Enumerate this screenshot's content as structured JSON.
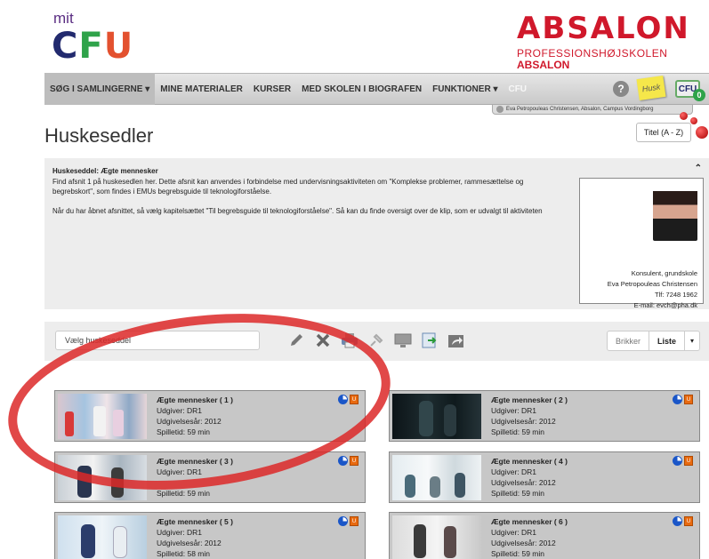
{
  "logo_left": {
    "mit": "mit",
    "c": "C",
    "f": "F",
    "u": "U"
  },
  "logo_right": {
    "name": "ABSALON",
    "sub1": "PROFESSIONSHØJSKOLEN",
    "sub2": "ABSALON"
  },
  "nav": {
    "items": [
      "SØG I SAMLINGERNE ▾",
      "MINE MATERIALER",
      "KURSER",
      "MED SKOLEN I BIOGRAFEN",
      "FUNKTIONER ▾",
      "CFU"
    ],
    "help": "?",
    "husk": "Husk",
    "cart_label": "CFU",
    "cart_count": "0"
  },
  "user": {
    "name": "Eva Petropouleas Christensen, Absalon, Campus Vordingborg"
  },
  "page_title": "Huskesedler",
  "sort": {
    "selected": "Titel (A - Z)"
  },
  "note": {
    "header": "Huskeseddel: Ægte mennesker",
    "p1": "Find afsnit 1 på huskesedlen her. Dette afsnit kan anvendes i forbindelse med undervisningsaktiviteten om \"Komplekse problemer, rammesættelse og begrebskort\", som findes i EMUs begrebsguide til teknologiforståelse.",
    "p2": "Når du har åbnet afsnittet, så vælg kapitelsættet \"Til begrebsguide til teknologiforståelse\". Så kan du finde oversigt over de klip, som er udvalgt til aktiviteten",
    "caret": "⌃"
  },
  "contact": {
    "role": "Konsulent, grundskole",
    "name": "Eva Petropouleas Christensen",
    "phone": "Tlf: 7248 1962",
    "email": "E-mail: evch@pha.dk"
  },
  "toolbar": {
    "select_placeholder": "Vælg huskeseddel",
    "view_bricks": "Brikker",
    "view_list": "Liste",
    "dd": "▾"
  },
  "cards": [
    {
      "title": "Ægte mennesker ( 1 )",
      "publisher": "Udgiver: DR1",
      "year": "Udgivelsesår: 2012",
      "duration": "Spilletid: 59 min",
      "badge": "U"
    },
    {
      "title": "Ægte mennesker ( 2 )",
      "publisher": "Udgiver: DR1",
      "year": "Udgivelsesår: 2012",
      "duration": "Spilletid: 59 min",
      "badge": "U"
    },
    {
      "title": "Ægte mennesker ( 3 )",
      "publisher": "Udgiver: DR1",
      "year": "",
      "duration": "Spilletid: 59 min",
      "badge": "U"
    },
    {
      "title": "Ægte mennesker ( 4 )",
      "publisher": "Udgiver: DR1",
      "year": "Udgivelsesår: 2012",
      "duration": "Spilletid: 59 min",
      "badge": "U"
    },
    {
      "title": "Ægte mennesker ( 5 )",
      "publisher": "Udgiver: DR1",
      "year": "Udgivelsesår: 2012",
      "duration": "Spilletid: 58 min",
      "badge": "U"
    },
    {
      "title": "Ægte mennesker ( 6 )",
      "publisher": "Udgiver: DR1",
      "year": "Udgivelsesår: 2012",
      "duration": "Spilletid: 59 min",
      "badge": "U"
    }
  ],
  "colors": {
    "brand_red": "#d0182b",
    "annotation_red": "#dc2828",
    "card_bg": "#c7c7c7"
  }
}
